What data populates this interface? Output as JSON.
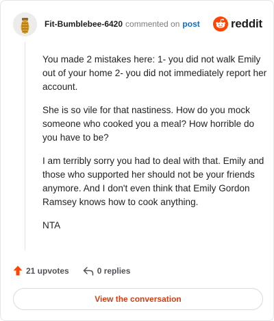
{
  "header": {
    "username": "Fit-Bumblebee-6420",
    "action_text": "commented on",
    "post_link": "post",
    "brand": "reddit"
  },
  "comment": {
    "paragraphs": [
      "You made 2 mistakes here: 1- you did not walk Emily out of your home 2- you did not immediately report her account.",
      "She is so vile for that nastiness. How do you mock someone who cooked you a meal? How horrible do you have to be?",
      "I am terribly sorry you had to deal with that. Emily and those who supported her should not be your friends anymore. And I don't even think that Emily Gordon Ramsey knows how to cook anything.",
      "NTA"
    ]
  },
  "actions": {
    "upvotes": "21 upvotes",
    "replies": "0 replies"
  },
  "cta": {
    "label": "View the conversation"
  },
  "colors": {
    "accent": "#ff4500",
    "link": "#0a6ec4",
    "cta_text": "#d03e12"
  }
}
